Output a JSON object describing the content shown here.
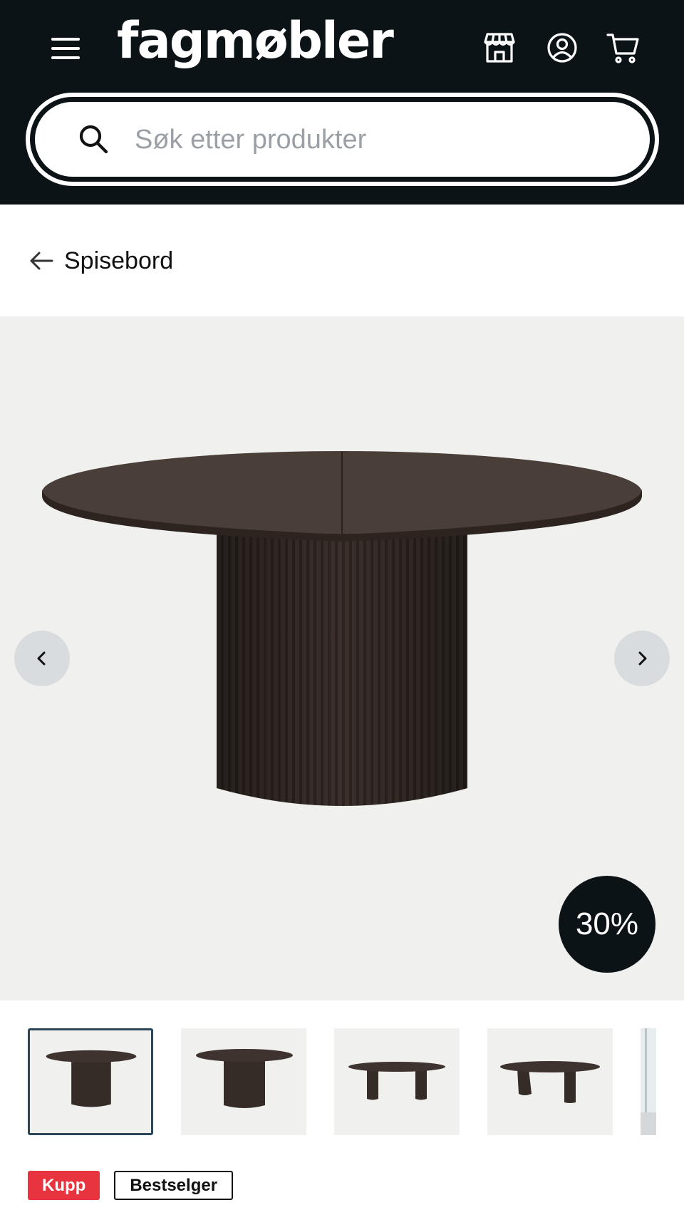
{
  "header": {
    "logo": "fagmøbler",
    "menu_icon": "hamburger-menu-icon",
    "icons": [
      "store-icon",
      "account-icon",
      "cart-icon"
    ]
  },
  "search": {
    "placeholder": "Søk etter produkter",
    "icon": "search-icon"
  },
  "breadcrumb": {
    "label": "Spisebord",
    "icon": "arrow-left-icon"
  },
  "gallery": {
    "discount": "30%",
    "prev_icon": "chevron-left-icon",
    "next_icon": "chevron-right-icon",
    "thumbnail_count": 5,
    "active_thumbnail": 1
  },
  "badges": {
    "kupp": "Kupp",
    "bestseller": "Bestselger"
  },
  "colors": {
    "header_bg": "#0b1317",
    "gallery_bg": "#f0f0ef",
    "wood": "#3a2f2a",
    "kupp_badge": "#e8343f",
    "thumb_active_border": "#2b4658"
  }
}
